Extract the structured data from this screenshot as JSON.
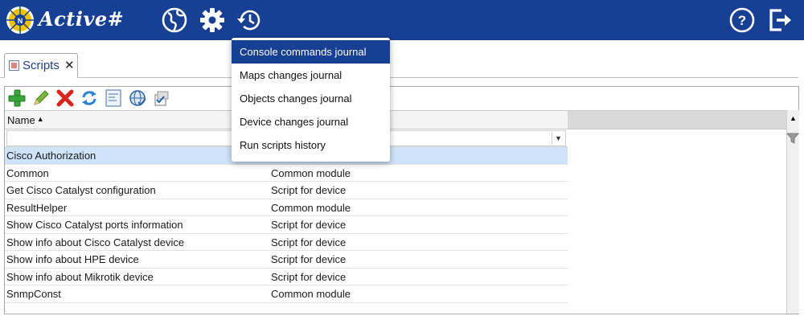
{
  "app": {
    "brand": "Active#",
    "colors": {
      "header": "#173f94",
      "selected_row": "#cfe3fa",
      "menu_active": "#173f94"
    }
  },
  "header": {
    "icons": [
      "globe-icon",
      "gear-icon",
      "history-icon",
      "help-icon",
      "logout-icon"
    ]
  },
  "history_menu": {
    "items": [
      {
        "label": "Console commands journal",
        "active": true
      },
      {
        "label": "Maps changes journal",
        "active": false
      },
      {
        "label": "Objects changes journal",
        "active": false
      },
      {
        "label": "Device changes journal",
        "active": false
      },
      {
        "label": "Run scripts history",
        "active": false
      }
    ]
  },
  "tabs": [
    {
      "label": "Scripts",
      "close": "✕"
    }
  ],
  "toolbar": {
    "buttons": [
      "add-icon",
      "edit-icon",
      "delete-icon",
      "refresh-icon",
      "script-icon",
      "globe-script-icon",
      "check-icon"
    ]
  },
  "grid": {
    "columns": [
      {
        "label": "Name",
        "sort": "▲"
      },
      {
        "label": ""
      }
    ],
    "filter_dropdown": "▼",
    "rows": [
      {
        "name": "Cisco Authorization",
        "type": "",
        "selected": true
      },
      {
        "name": "Common",
        "type": "Common module"
      },
      {
        "name": "Get Cisco Catalyst configuration",
        "type": "Script for device"
      },
      {
        "name": "ResultHelper",
        "type": "Common module"
      },
      {
        "name": "Show Cisco Catalyst ports information",
        "type": "Script for device"
      },
      {
        "name": "Show info about Cisco Catalyst device",
        "type": "Script for device"
      },
      {
        "name": "Show info about HPE device",
        "type": "Script for device"
      },
      {
        "name": "Show info about Mikrotik device",
        "type": "Script for device"
      },
      {
        "name": "SnmpConst",
        "type": "Common module"
      }
    ]
  },
  "scroll": {
    "up": "▲"
  }
}
